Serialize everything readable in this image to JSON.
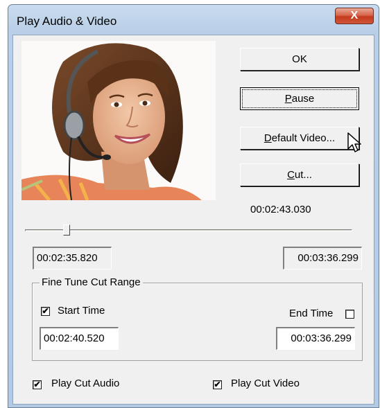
{
  "window": {
    "title": "Play Audio & Video",
    "close_label": "X"
  },
  "buttons": {
    "ok": "OK",
    "pause": {
      "mnemonic": "P",
      "rest": "ause"
    },
    "default_video": {
      "mnemonic": "D",
      "rest": "efault Video..."
    },
    "cut": {
      "mnemonic": "C",
      "rest": "ut..."
    }
  },
  "current_time": "00:02:43.030",
  "playback": {
    "position_fraction": 0.12,
    "start_value": "00:02:35.820",
    "end_value": "00:03:36.299"
  },
  "fine_tune": {
    "group_label": "Fine Tune Cut Range",
    "start_time_label": "Start Time",
    "start_time_checked": true,
    "start_time_value": "00:02:40.520",
    "end_time_label": "End Time",
    "end_time_checked": false,
    "end_time_value": "00:03:36.299"
  },
  "options": {
    "play_cut_audio_label": "Play Cut Audio",
    "play_cut_audio_checked": true,
    "play_cut_video_label": "Play Cut Video",
    "play_cut_video_checked": true
  },
  "icons": {
    "cursor": "arrow-cursor-icon",
    "check": "checkmark-icon"
  },
  "colors": {
    "title_bar": "#b9cfe8",
    "close_button": "#c5391d",
    "dialog_bg": "#f0f0f0"
  }
}
